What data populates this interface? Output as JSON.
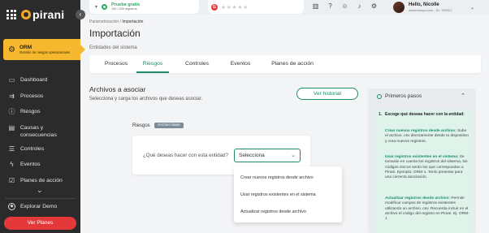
{
  "sidebar": {
    "logo_text": "pirani",
    "module": {
      "title": "ORM",
      "subtitle": "Gestión de riesgos operacionales"
    },
    "items": [
      {
        "label": "Dashboard",
        "icon": "monitor-icon"
      },
      {
        "label": "Procesos",
        "icon": "process-icon"
      },
      {
        "label": "Riesgos",
        "icon": "warning-icon"
      },
      {
        "label": "Causas y consecuencias",
        "icon": "document-icon"
      },
      {
        "label": "Controles",
        "icon": "sliders-icon"
      },
      {
        "label": "Eventos",
        "icon": "lightning-icon"
      },
      {
        "label": "Planes de acción",
        "icon": "checklist-icon"
      }
    ],
    "explore_label": "Explorar Demo",
    "plans_button": "Ver Planes"
  },
  "topbar": {
    "trial_title": "Prueba gratis",
    "trial_sub": "100 / 200 registros",
    "user_hello": "Hello, Nicolle",
    "user_sub": "www.tuespa.com - ID: 789021"
  },
  "page": {
    "breadcrumb_parent": "Parametrización",
    "breadcrumb_sep": " / ",
    "breadcrumb_current": "Importación",
    "title": "Importación",
    "description": "Entidades del sistema"
  },
  "tabs": [
    "Procesos",
    "Riesgos",
    "Controles",
    "Eventos",
    "Planes de acción"
  ],
  "active_tab": "Riesgos",
  "section": {
    "title": "Archivos a asociar",
    "description": "Selecciona y carga los archivos que deseas asociar.",
    "history_button": "Ver historial"
  },
  "entity": {
    "label": "Riesgos",
    "badge": "Archivo base",
    "question": "¿Qué deseas hacer con esta entidad?",
    "select_value": "Selecciona",
    "options": [
      "Crear nuevos registros desde archivo",
      "Usar registros existentes en el sistema",
      "Actualizar registros desde archivo"
    ]
  },
  "help": {
    "title": "Primeros pasos",
    "step_number": "1.",
    "step_question": "Escoge qué deseas hacer con la entidad:",
    "blocks": [
      {
        "heading": "Crear nuevos registros desde archivo:",
        "text": "Sube el archivo .csv directamente desde tu dispositivo y crea nuevos registros."
      },
      {
        "heading": "Usar registros existentes en el sistema:",
        "text": "Se tomarán en cuenta los registros del sistema, los códigos únicos serán los que correspondan a Pirani. Ejemplo: ORM-1. Tenlo presente para una correcta asociación."
      },
      {
        "heading": "Actualizar registros desde archivo:",
        "text": "Permite modificar campos de registros existentes utilizando un archivo .csv. Recuerda incluir en el archivo el código del registro en Pirani. Ej. ORM-1"
      }
    ]
  },
  "colors": {
    "accent": "#1e8a6a",
    "module": "#f5b82e",
    "danger": "#e5383b",
    "sidebar": "#2b2b2b"
  }
}
